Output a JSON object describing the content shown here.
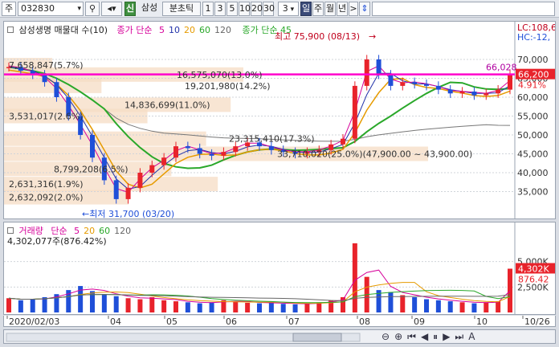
{
  "toolbar": {
    "market_label": "주",
    "stock_code": "032830",
    "credit_badge": "신",
    "stock_name": "삼성",
    "period_tab": "분초틱",
    "period_nums": [
      "1",
      "3",
      "5",
      "10",
      "20",
      "30"
    ],
    "count_value": "3",
    "day_tab": "일",
    "week_tab": "주",
    "month_tab": "월",
    "year_tab": "년",
    "nav_next": ">"
  },
  "price_legend": {
    "title": "삼성생명 매물대 수(10)",
    "ma_label": "종가 단순",
    "ma_periods": [
      "5",
      "10",
      "20",
      "60",
      "120"
    ],
    "ma_colors": [
      "#d6009a",
      "#2233aa",
      "#e69b00",
      "#2aa82a",
      "#666666"
    ],
    "ma2_label": "종가 단순 45",
    "ma2_color": "#2aa82a"
  },
  "price_annotations": {
    "high_label": "최고 75,900 (08/13)",
    "low_label": "최저 31,700 (03/20)",
    "hline_label": "66,028",
    "current_label": "66,200",
    "change_pct": "4.91%",
    "lc_label": "LC:108,6",
    "hc_label": "HC:-12,"
  },
  "volume_profile": [
    {
      "text": "7,658,847(5.7%)",
      "level": 68500
    },
    {
      "text": "16,575,070(13.0%)",
      "level": 66000
    },
    {
      "text": "19,201,980(14.2%)",
      "level": 63000
    },
    {
      "text": "14,836,699(11.0%)",
      "level": 58000
    },
    {
      "text": "3,531,017(2.6%)",
      "level": 55000
    },
    {
      "text": "23,315,410(17.3%)",
      "level": 49000
    },
    {
      "text": "33,710,020(25.0%)(47,900.00 ~ 43,900.00)",
      "level": 45000
    },
    {
      "text": "8,799,208(6.5%)",
      "level": 41000
    },
    {
      "text": "2,631,316(1.9%)",
      "level": 37000
    },
    {
      "text": "2,632,092(2.0%)",
      "level": 33500
    }
  ],
  "price_axis": {
    "ticks": [
      "70,000",
      "65,000",
      "60,000",
      "55,000",
      "50,000",
      "45,000",
      "40,000",
      "35,000"
    ],
    "tick_values": [
      70000,
      65000,
      60000,
      55000,
      50000,
      45000,
      40000,
      35000
    ],
    "min": 30000,
    "max": 80000
  },
  "volume_legend": {
    "title": "거래량",
    "ma_label": "단순",
    "ma_periods": [
      "5",
      "20",
      "60",
      "120"
    ],
    "info": "4,302,077주(876.42%)"
  },
  "volume_axis": {
    "ticks": [
      "5,000K",
      "2,500K"
    ],
    "current_label": "4,302K",
    "pct_label": "876.42"
  },
  "x_axis": {
    "labels": [
      "2020/02/03",
      "04",
      "05",
      "06",
      "07",
      "08",
      "09",
      "10",
      "10/26"
    ]
  },
  "colors": {
    "up": "#e8232b",
    "down": "#1f4fd8",
    "hline": "#ff00cc",
    "profile_fill": "#f6dcc4"
  },
  "chart_data": {
    "type": "candlestick",
    "x_start": "2020/02/03",
    "x_end": "10/26",
    "high": {
      "value": 75900,
      "date": "08/13"
    },
    "low": {
      "value": 31700,
      "date": "03/20"
    },
    "last_close": 66200,
    "close_trend": [
      68000,
      67000,
      66000,
      64000,
      60000,
      55000,
      50000,
      44000,
      38000,
      33000,
      36000,
      40000,
      42000,
      44000,
      47000,
      46500,
      45000,
      44500,
      45500,
      47000,
      48000,
      47000,
      46000,
      45500,
      45000,
      45500,
      46000,
      47500,
      49000,
      63000,
      70000,
      66000,
      63000,
      64000,
      63500,
      63000,
      62000,
      61000,
      61500,
      60500,
      61000,
      62000,
      66200
    ],
    "volume_trend": [
      1400,
      1200,
      1300,
      1500,
      1800,
      2200,
      2600,
      2100,
      1800,
      1600,
      1400,
      1300,
      1500,
      1200,
      1100,
      1000,
      900,
      1000,
      1200,
      1100,
      950,
      900,
      1000,
      850,
      800,
      900,
      1000,
      1200,
      1500,
      6800,
      3500,
      2200,
      2000,
      1700,
      1500,
      1300,
      1200,
      1100,
      1000,
      900,
      1000,
      1100,
      4302
    ]
  }
}
